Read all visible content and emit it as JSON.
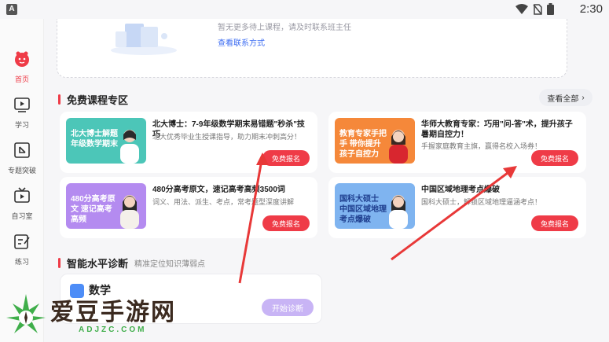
{
  "status_bar": {
    "app_letter": "A",
    "time": "2:30",
    "icons": [
      "wifi-icon",
      "no-sim-icon",
      "battery-icon"
    ]
  },
  "sidebar": {
    "items": [
      {
        "label": "首页",
        "icon": "home-mascot-icon",
        "active": true
      },
      {
        "label": "学习",
        "icon": "play-video-icon",
        "active": false
      },
      {
        "label": "专题突破",
        "icon": "breakthrough-icon",
        "active": false
      },
      {
        "label": "自习室",
        "icon": "tv-study-room-icon",
        "active": false
      },
      {
        "label": "练习",
        "icon": "practice-edit-icon",
        "active": false
      }
    ]
  },
  "empty_state": {
    "message": "暂无更多待上课程，请及时联系班主任",
    "link": "查看联系方式"
  },
  "free_courses": {
    "title": "免费课程专区",
    "view_all": "查看全部",
    "courses": [
      {
        "title": "北大博士：7-9年级数学期末易错题\"秒杀\"技巧",
        "desc": "北大优秀毕业生授课指导，助力期末冲刺高分！",
        "button": "免费报名",
        "thumb_text": "北大博士解题 年级数学期末",
        "thumb_color": "#4cc6b8"
      },
      {
        "title": "华师大教育专家：巧用\"问-答\"术，提升孩子暑期自控力！",
        "desc": "手握家庭教育主旗，赢得名校入场券！",
        "button": "免费报名",
        "thumb_text": "教育专家手把手 带你提升孩子自控力",
        "thumb_color": "#f5883a"
      },
      {
        "title": "480分高考原文，速记高考高频3500词",
        "desc": "词义、用法、派生、考点，常考题型深度讲解",
        "button": "免费报名",
        "thumb_text": "480分高考原文 速记高考高频",
        "thumb_color": "#b48bf0"
      },
      {
        "title": "中国区域地理考点爆破",
        "desc": "国科大硕士，解锁区域地理逼涵考点！",
        "button": "免费报名",
        "thumb_text": "国科大硕士 中国区域地理考点爆破",
        "thumb_color": "#7fb4f0"
      }
    ]
  },
  "diagnosis": {
    "title": "智能水平诊断",
    "subtitle": "精准定位知识薄弱点",
    "subject": "数学",
    "button": "开始诊断"
  },
  "watermark": {
    "title": "爱豆手游网",
    "domain": "ADJZC.COM"
  },
  "colors": {
    "accent": "#ef3b47",
    "link": "#3d6df2",
    "diagnose_button": "#c8b4f5"
  }
}
